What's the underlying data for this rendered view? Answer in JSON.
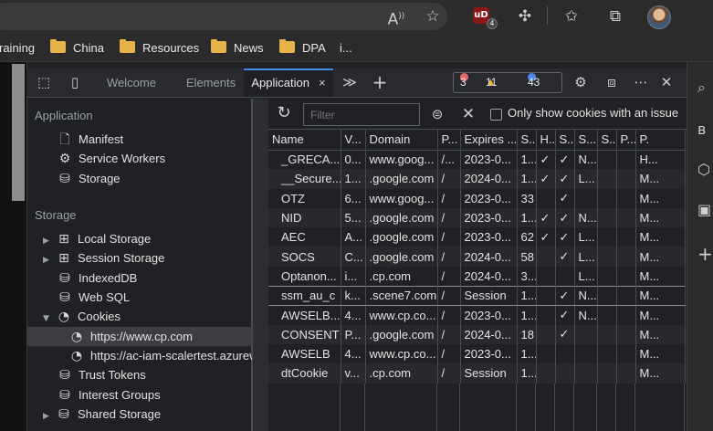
{
  "toolbar": {
    "icons": [
      "read-aloud-icon",
      "add-favorite-icon",
      "ublock-icon",
      "extensions-icon",
      "favorites-icon",
      "collections-icon",
      "profile-avatar"
    ],
    "read_aloud_glyph": "A",
    "ublock_label": "uD",
    "ublock_badge": "4"
  },
  "bookmarks": {
    "partial_label": "raining",
    "items": [
      "China",
      "Resources",
      "News",
      "DPA"
    ],
    "overflow": "i..."
  },
  "devtools": {
    "tabs": [
      "Welcome",
      "Elements",
      "Application"
    ],
    "active_tab": "Application",
    "close_glyph": "×",
    "more_tabs_glyph": "≫",
    "add_tab_glyph": "+",
    "errors": "3",
    "warnings": "11",
    "messages": "43",
    "more_glyph": "⋯",
    "close_devtools_glyph": "✕"
  },
  "sidebar": {
    "application_heading": "Application",
    "application_items": [
      {
        "label": "Manifest",
        "icon": "document-icon"
      },
      {
        "label": "Service Workers",
        "icon": "gear-icon"
      },
      {
        "label": "Storage",
        "icon": "database-icon"
      }
    ],
    "storage_heading": "Storage",
    "storage_items": [
      {
        "label": "Local Storage",
        "icon": "grid-icon",
        "arrow": "▶"
      },
      {
        "label": "Session Storage",
        "icon": "grid-icon",
        "arrow": "▶"
      },
      {
        "label": "IndexedDB",
        "icon": "database-icon"
      },
      {
        "label": "Web SQL",
        "icon": "database-icon"
      },
      {
        "label": "Cookies",
        "icon": "cookie-icon",
        "arrow": "▼"
      },
      {
        "label": "https://www.cp.com",
        "icon": "cookie-icon"
      },
      {
        "label": "https://ac-iam-scalertest.azurew",
        "icon": "cookie-icon"
      },
      {
        "label": "Trust Tokens",
        "icon": "database-icon"
      },
      {
        "label": "Interest Groups",
        "icon": "database-icon"
      },
      {
        "label": "Shared Storage",
        "icon": "database-icon",
        "arrow": "▶"
      }
    ]
  },
  "cookies": {
    "filter_placeholder": "Filter",
    "only_issue_label": "Only show cookies with an issue",
    "columns": [
      "Name",
      "V...",
      "Domain",
      "P...",
      "Expires ...",
      "S...",
      "H...",
      "S...",
      "S...",
      "S...",
      "P...",
      "P."
    ],
    "rows": [
      [
        "_GRECA...",
        "0...",
        "www.goog...",
        "/...",
        "2023-0...",
        "1...",
        "✓",
        "✓",
        "N...",
        "",
        "",
        "H..."
      ],
      [
        "__Secure...",
        "1...",
        ".google.com",
        "/",
        "2024-0...",
        "1...",
        "✓",
        "✓",
        "L...",
        "",
        "",
        "M..."
      ],
      [
        "OTZ",
        "6...",
        "www.goog...",
        "/",
        "2023-0...",
        "33",
        "",
        "✓",
        "",
        "",
        "",
        "M..."
      ],
      [
        "NID",
        "5...",
        ".google.com",
        "/",
        "2023-0...",
        "1...",
        "✓",
        "✓",
        "N...",
        "",
        "",
        "M..."
      ],
      [
        "AEC",
        "A...",
        ".google.com",
        "/",
        "2023-0...",
        "62",
        "✓",
        "✓",
        "L...",
        "",
        "",
        "M..."
      ],
      [
        "SOCS",
        "C...",
        ".google.com",
        "/",
        "2024-0...",
        "58",
        "",
        "✓",
        "L...",
        "",
        "",
        "M..."
      ],
      [
        "Optanon...",
        "i...",
        ".cp.com",
        "/",
        "2024-0...",
        "3...",
        "",
        "",
        "L...",
        "",
        "",
        "M..."
      ],
      [
        "ssm_au_c",
        "k...",
        ".scene7.com",
        "/",
        "Session",
        "1...",
        "",
        "✓",
        "N...",
        "",
        "",
        "M..."
      ],
      [
        "AWSELB...",
        "4...",
        "www.cp.co...",
        "/",
        "2023-0...",
        "1...",
        "",
        "✓",
        "N...",
        "",
        "",
        "M..."
      ],
      [
        "CONSENT",
        "P...",
        ".google.com",
        "/",
        "2024-0...",
        "18",
        "",
        "✓",
        "",
        "",
        "",
        "M..."
      ],
      [
        "AWSELB",
        "4...",
        "www.cp.co...",
        "/",
        "2023-0...",
        "1...",
        "",
        "",
        "",
        "",
        "",
        "M..."
      ],
      [
        "dtCookie",
        "v...",
        ".cp.com",
        "/",
        "Session",
        "1...",
        "",
        "",
        "",
        "",
        "",
        "M..."
      ]
    ],
    "highlighted_row": 7
  },
  "colors": {
    "accent": "#4a8bea",
    "error": "#e46962",
    "warning": "#f2b620",
    "info": "#4a8bea",
    "folder": "#e5b34a"
  }
}
